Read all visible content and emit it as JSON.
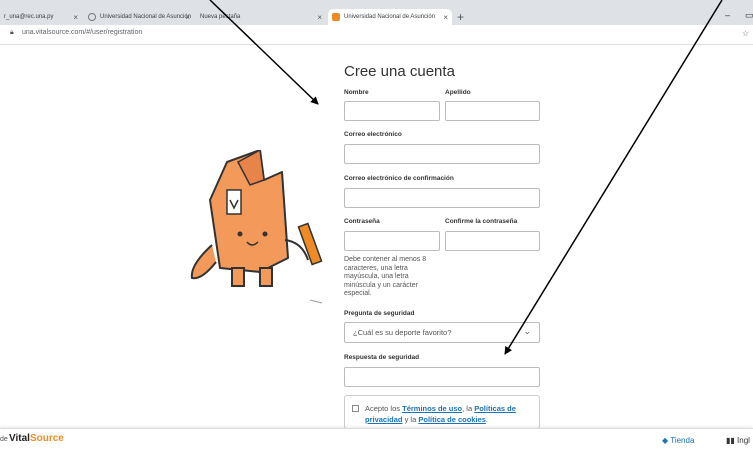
{
  "browser": {
    "tabs": [
      {
        "label": "r_una@rec.una.py",
        "favicon": "mail"
      },
      {
        "label": "Universidad Nacional de Asunción",
        "favicon": "globe"
      },
      {
        "label": "Nueva pestaña",
        "favicon": "none"
      },
      {
        "label": "Universidad Nacional de Asunción",
        "favicon": "vitalsource",
        "active": true
      }
    ],
    "new_tab": "+",
    "minimize": "–",
    "restore": "▭",
    "url": "una.vitalsource.com/#/user/registration"
  },
  "form": {
    "title": "Cree una cuenta",
    "nombre_label": "Nombre",
    "apellido_label": "Apellido",
    "correo_label": "Correo electrónico",
    "correo_confirm_label": "Correo electrónico de confirmación",
    "contrasena_label": "Contraseña",
    "confirme_label": "Confirme la contraseña",
    "password_hint": "Debe contener al menos 8 caracteres, una letra mayúscula, una letra minúscula y un carácter especial.",
    "pregunta_label": "Pregunta de seguridad",
    "pregunta_value": "¿Cuál es su deporte favorito?",
    "respuesta_label": "Respuesta de seguridad",
    "terms_prefix": "Acepto los ",
    "terms_link": "Términos de uso",
    "terms_mid": ", la ",
    "privacy_link": "Políticas de privacidad",
    "terms_and": " y la ",
    "cookies_link": "Política de cookies",
    "terms_end": "."
  },
  "footer": {
    "de": "de",
    "brand_vital": "Vital",
    "brand_source": "Source",
    "tienda": "Tienda",
    "lang": "Ingl"
  },
  "colors": {
    "accent": "#f08a24",
    "link": "#1a73b8",
    "annotation_arrow": "#000000"
  }
}
